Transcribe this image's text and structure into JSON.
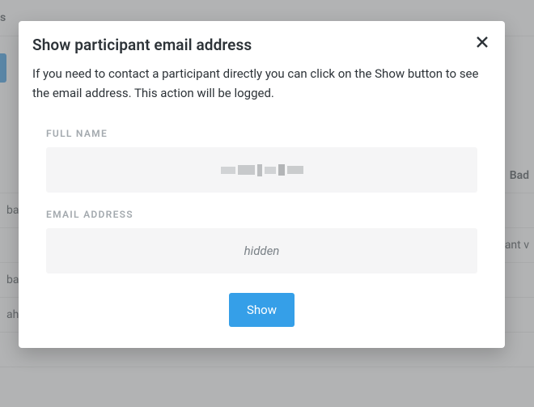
{
  "background": {
    "tab_fragment": "s",
    "table": {
      "header_right": "Bad",
      "rows": [
        {
          "left": "ba",
          "right": ""
        },
        {
          "left": "",
          "right": "pant v"
        },
        {
          "left": "ba",
          "right": ""
        },
        {
          "left": "ahc",
          "right": ""
        }
      ]
    }
  },
  "modal": {
    "title": "Show participant email address",
    "description": "If you need to contact a participant directly you can click on the Show button to see the email address. This action will be logged.",
    "fields": {
      "full_name": {
        "label": "FULL NAME"
      },
      "email": {
        "label": "EMAIL ADDRESS",
        "value": "hidden"
      }
    },
    "actions": {
      "show_label": "Show"
    }
  }
}
